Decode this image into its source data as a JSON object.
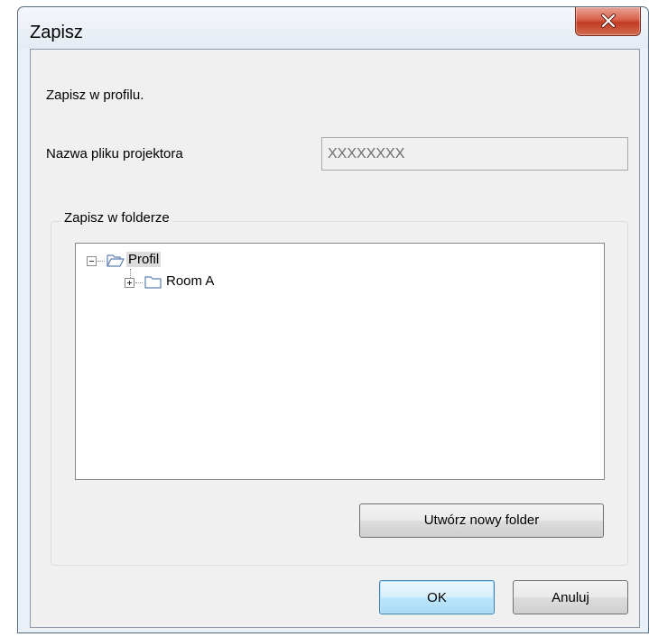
{
  "window": {
    "title": "Zapisz"
  },
  "dialog": {
    "instruction": "Zapisz w profilu.",
    "filename_label": "Nazwa pliku projektora",
    "filename_value": "XXXXXXXX",
    "folder_group_label": "Zapisz w folderze",
    "tree": {
      "root": {
        "label": "Profil",
        "expanded": true,
        "selected": true
      },
      "children": [
        {
          "label": "Room A",
          "expanded": false
        }
      ]
    },
    "new_folder_label": "Utwórz nowy folder",
    "ok_label": "OK",
    "cancel_label": "Anuluj"
  },
  "colors": {
    "close_button": "#c23b23",
    "default_button": "#bee6fd",
    "client_bg": "#f0f0f0",
    "frame_bg": "#eaf0f7"
  },
  "icons": [
    "close-icon",
    "collapse-icon",
    "expand-icon",
    "open-folder-icon",
    "folder-icon"
  ]
}
